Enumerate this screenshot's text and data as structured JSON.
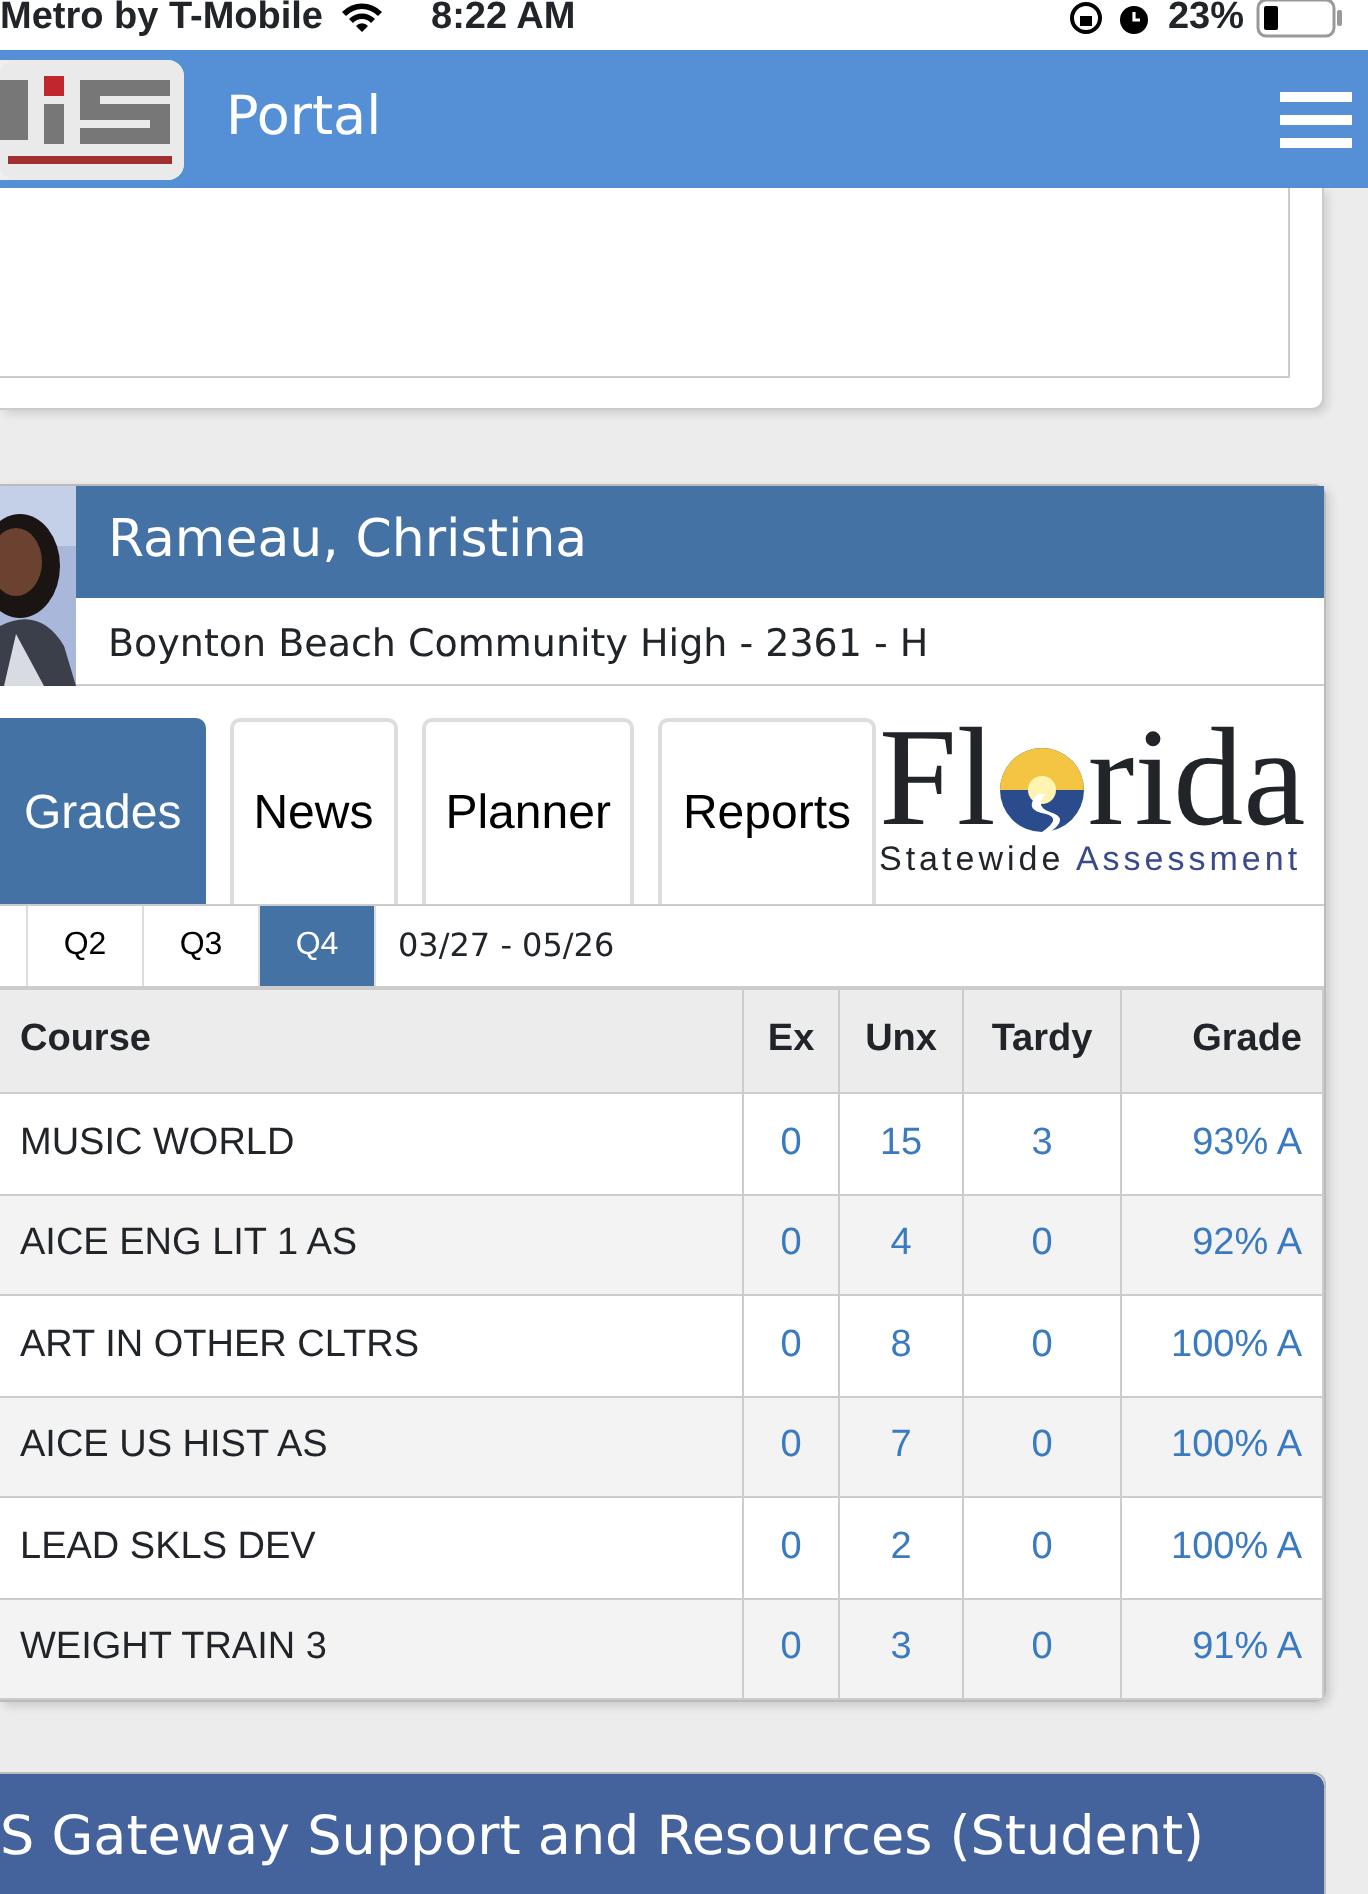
{
  "status_bar": {
    "carrier": "Metro by T-Mobile",
    "time": "8:22 AM",
    "battery": "23%"
  },
  "navbar": {
    "title": "Portal"
  },
  "student": {
    "name": "Rameau, Christina",
    "school": "Boynton Beach Community High - 2361 - H"
  },
  "tabs": [
    {
      "label": "Grades",
      "selected": true
    },
    {
      "label": "News",
      "selected": false
    },
    {
      "label": "Planner",
      "selected": false
    },
    {
      "label": "Reports",
      "selected": false
    }
  ],
  "logo": {
    "word_start": "Fl",
    "word_end": "rida",
    "tagline_start": "Statewide",
    "tagline_end": "Assessment"
  },
  "quarters": [
    {
      "label": "Q2",
      "selected": false
    },
    {
      "label": "Q3",
      "selected": false
    },
    {
      "label": "Q4",
      "selected": true
    }
  ],
  "date_range": "03/27 - 05/26",
  "table": {
    "columns": [
      "Course",
      "Ex",
      "Unx",
      "Tardy",
      "Grade"
    ],
    "rows": [
      [
        "MUSIC WORLD",
        "0",
        "15",
        "3",
        "93% A"
      ],
      [
        "AICE ENG LIT 1 AS",
        "0",
        "4",
        "0",
        "92% A"
      ],
      [
        "ART IN OTHER CLTRS",
        "0",
        "8",
        "0",
        "100% A"
      ],
      [
        "AICE US HIST AS",
        "0",
        "7",
        "0",
        "100% A"
      ],
      [
        "LEAD SKLS DEV",
        "0",
        "2",
        "0",
        "100% A"
      ],
      [
        "WEIGHT TRAIN 3",
        "0",
        "3",
        "0",
        "91% A"
      ]
    ]
  },
  "bottom_panel": {
    "title": "S Gateway Support and Resources (Student)"
  }
}
